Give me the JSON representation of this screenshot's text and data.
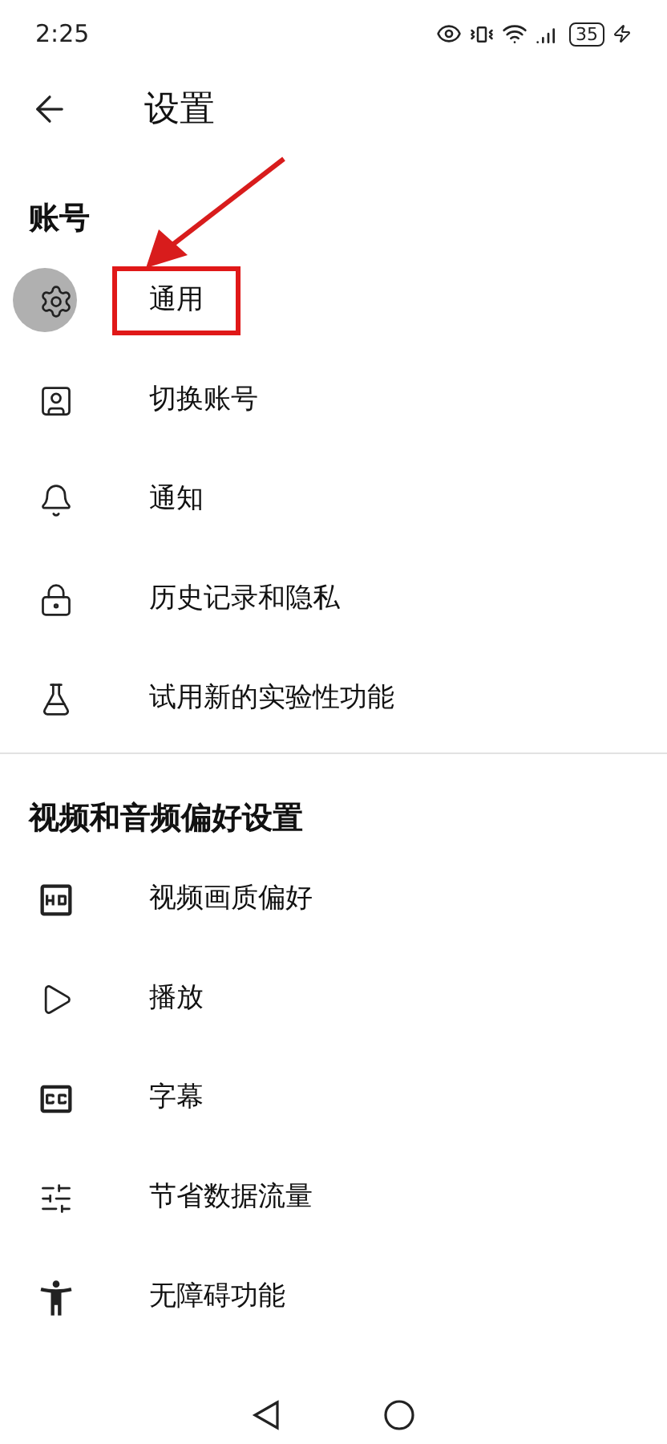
{
  "status_bar": {
    "time": "2:25",
    "battery": "35"
  },
  "header": {
    "title": "设置"
  },
  "sections": [
    {
      "title": "账号",
      "items": [
        {
          "label": "通用",
          "highlighted": true
        },
        {
          "label": "切换账号",
          "highlighted": false
        },
        {
          "label": "通知",
          "highlighted": false
        },
        {
          "label": "历史记录和隐私",
          "highlighted": false
        },
        {
          "label": "试用新的实验性功能",
          "highlighted": false
        }
      ]
    },
    {
      "title": "视频和音频偏好设置",
      "items": [
        {
          "label": "视频画质偏好",
          "highlighted": false
        },
        {
          "label": "播放",
          "highlighted": false
        },
        {
          "label": "字幕",
          "highlighted": false
        },
        {
          "label": "节省数据流量",
          "highlighted": false
        },
        {
          "label": "无障碍功能",
          "highlighted": false
        }
      ]
    }
  ]
}
